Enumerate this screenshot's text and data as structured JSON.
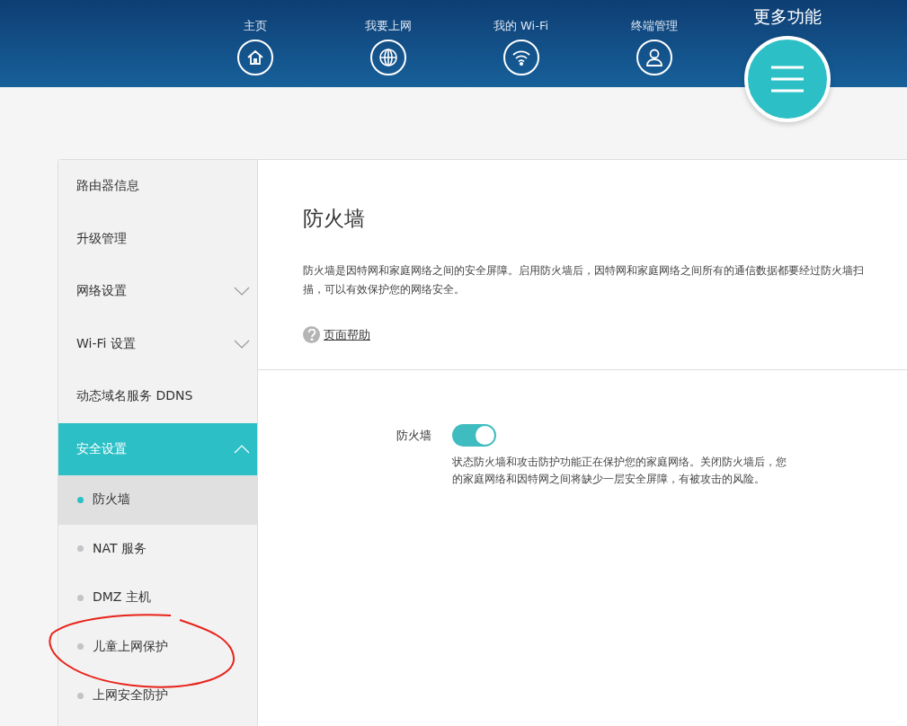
{
  "nav": [
    {
      "label": "主页",
      "selected": false
    },
    {
      "label": "我要上网",
      "selected": false
    },
    {
      "label": "我的 Wi-Fi",
      "selected": false
    },
    {
      "label": "终端管理",
      "selected": false
    },
    {
      "label": "更多功能",
      "selected": true
    }
  ],
  "sidebar": {
    "items": [
      {
        "label": "路由器信息",
        "selected": false
      },
      {
        "label": "升级管理",
        "selected": false
      },
      {
        "label": "网络设置",
        "selected": false,
        "expanded": false
      },
      {
        "label": "Wi-Fi 设置",
        "selected": false,
        "expanded": false
      },
      {
        "label": "动态域名服务 DDNS",
        "selected": false
      },
      {
        "label": "安全设置",
        "selected": true,
        "expanded": true,
        "children": [
          {
            "label": "防火墙",
            "selected": true
          },
          {
            "label": "NAT 服务",
            "selected": false
          },
          {
            "label": "DMZ 主机",
            "selected": false
          },
          {
            "label": "儿童上网保护",
            "selected": false
          },
          {
            "label": "上网安全防护",
            "selected": false
          }
        ]
      }
    ]
  },
  "content": {
    "title": "防火墙",
    "description": "防火墙是因特网和家庭网络之间的安全屏障。启用防火墙后，因特网和家庭网络之间所有的通信数据都要经过防火墙扫描，可以有效保护您的网络安全。",
    "help_link": "页面帮助",
    "setting": {
      "label": "防火墙",
      "on": true,
      "hint": "状态防火墙和攻击防护功能正在保护您的家庭网络。关闭防火墙后，您的家庭网络和因特网之间将缺少一层安全屏障，有被攻击的风险。"
    }
  }
}
